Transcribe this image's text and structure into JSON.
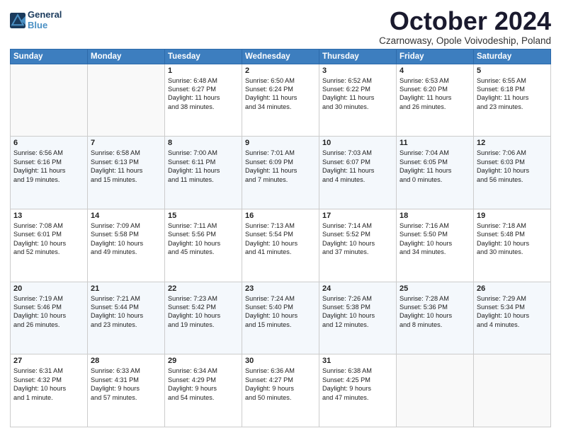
{
  "header": {
    "logo_line1": "General",
    "logo_line2": "Blue",
    "month": "October 2024",
    "location": "Czarnowasy, Opole Voivodeship, Poland"
  },
  "weekdays": [
    "Sunday",
    "Monday",
    "Tuesday",
    "Wednesday",
    "Thursday",
    "Friday",
    "Saturday"
  ],
  "weeks": [
    [
      {
        "day": "",
        "lines": [],
        "empty": true
      },
      {
        "day": "",
        "lines": [],
        "empty": true
      },
      {
        "day": "1",
        "lines": [
          "Sunrise: 6:48 AM",
          "Sunset: 6:27 PM",
          "Daylight: 11 hours",
          "and 38 minutes."
        ]
      },
      {
        "day": "2",
        "lines": [
          "Sunrise: 6:50 AM",
          "Sunset: 6:24 PM",
          "Daylight: 11 hours",
          "and 34 minutes."
        ]
      },
      {
        "day": "3",
        "lines": [
          "Sunrise: 6:52 AM",
          "Sunset: 6:22 PM",
          "Daylight: 11 hours",
          "and 30 minutes."
        ]
      },
      {
        "day": "4",
        "lines": [
          "Sunrise: 6:53 AM",
          "Sunset: 6:20 PM",
          "Daylight: 11 hours",
          "and 26 minutes."
        ]
      },
      {
        "day": "5",
        "lines": [
          "Sunrise: 6:55 AM",
          "Sunset: 6:18 PM",
          "Daylight: 11 hours",
          "and 23 minutes."
        ]
      }
    ],
    [
      {
        "day": "6",
        "lines": [
          "Sunrise: 6:56 AM",
          "Sunset: 6:16 PM",
          "Daylight: 11 hours",
          "and 19 minutes."
        ]
      },
      {
        "day": "7",
        "lines": [
          "Sunrise: 6:58 AM",
          "Sunset: 6:13 PM",
          "Daylight: 11 hours",
          "and 15 minutes."
        ]
      },
      {
        "day": "8",
        "lines": [
          "Sunrise: 7:00 AM",
          "Sunset: 6:11 PM",
          "Daylight: 11 hours",
          "and 11 minutes."
        ]
      },
      {
        "day": "9",
        "lines": [
          "Sunrise: 7:01 AM",
          "Sunset: 6:09 PM",
          "Daylight: 11 hours",
          "and 7 minutes."
        ]
      },
      {
        "day": "10",
        "lines": [
          "Sunrise: 7:03 AM",
          "Sunset: 6:07 PM",
          "Daylight: 11 hours",
          "and 4 minutes."
        ]
      },
      {
        "day": "11",
        "lines": [
          "Sunrise: 7:04 AM",
          "Sunset: 6:05 PM",
          "Daylight: 11 hours",
          "and 0 minutes."
        ]
      },
      {
        "day": "12",
        "lines": [
          "Sunrise: 7:06 AM",
          "Sunset: 6:03 PM",
          "Daylight: 10 hours",
          "and 56 minutes."
        ]
      }
    ],
    [
      {
        "day": "13",
        "lines": [
          "Sunrise: 7:08 AM",
          "Sunset: 6:01 PM",
          "Daylight: 10 hours",
          "and 52 minutes."
        ]
      },
      {
        "day": "14",
        "lines": [
          "Sunrise: 7:09 AM",
          "Sunset: 5:58 PM",
          "Daylight: 10 hours",
          "and 49 minutes."
        ]
      },
      {
        "day": "15",
        "lines": [
          "Sunrise: 7:11 AM",
          "Sunset: 5:56 PM",
          "Daylight: 10 hours",
          "and 45 minutes."
        ]
      },
      {
        "day": "16",
        "lines": [
          "Sunrise: 7:13 AM",
          "Sunset: 5:54 PM",
          "Daylight: 10 hours",
          "and 41 minutes."
        ]
      },
      {
        "day": "17",
        "lines": [
          "Sunrise: 7:14 AM",
          "Sunset: 5:52 PM",
          "Daylight: 10 hours",
          "and 37 minutes."
        ]
      },
      {
        "day": "18",
        "lines": [
          "Sunrise: 7:16 AM",
          "Sunset: 5:50 PM",
          "Daylight: 10 hours",
          "and 34 minutes."
        ]
      },
      {
        "day": "19",
        "lines": [
          "Sunrise: 7:18 AM",
          "Sunset: 5:48 PM",
          "Daylight: 10 hours",
          "and 30 minutes."
        ]
      }
    ],
    [
      {
        "day": "20",
        "lines": [
          "Sunrise: 7:19 AM",
          "Sunset: 5:46 PM",
          "Daylight: 10 hours",
          "and 26 minutes."
        ]
      },
      {
        "day": "21",
        "lines": [
          "Sunrise: 7:21 AM",
          "Sunset: 5:44 PM",
          "Daylight: 10 hours",
          "and 23 minutes."
        ]
      },
      {
        "day": "22",
        "lines": [
          "Sunrise: 7:23 AM",
          "Sunset: 5:42 PM",
          "Daylight: 10 hours",
          "and 19 minutes."
        ]
      },
      {
        "day": "23",
        "lines": [
          "Sunrise: 7:24 AM",
          "Sunset: 5:40 PM",
          "Daylight: 10 hours",
          "and 15 minutes."
        ]
      },
      {
        "day": "24",
        "lines": [
          "Sunrise: 7:26 AM",
          "Sunset: 5:38 PM",
          "Daylight: 10 hours",
          "and 12 minutes."
        ]
      },
      {
        "day": "25",
        "lines": [
          "Sunrise: 7:28 AM",
          "Sunset: 5:36 PM",
          "Daylight: 10 hours",
          "and 8 minutes."
        ]
      },
      {
        "day": "26",
        "lines": [
          "Sunrise: 7:29 AM",
          "Sunset: 5:34 PM",
          "Daylight: 10 hours",
          "and 4 minutes."
        ]
      }
    ],
    [
      {
        "day": "27",
        "lines": [
          "Sunrise: 6:31 AM",
          "Sunset: 4:32 PM",
          "Daylight: 10 hours",
          "and 1 minute."
        ]
      },
      {
        "day": "28",
        "lines": [
          "Sunrise: 6:33 AM",
          "Sunset: 4:31 PM",
          "Daylight: 9 hours",
          "and 57 minutes."
        ]
      },
      {
        "day": "29",
        "lines": [
          "Sunrise: 6:34 AM",
          "Sunset: 4:29 PM",
          "Daylight: 9 hours",
          "and 54 minutes."
        ]
      },
      {
        "day": "30",
        "lines": [
          "Sunrise: 6:36 AM",
          "Sunset: 4:27 PM",
          "Daylight: 9 hours",
          "and 50 minutes."
        ]
      },
      {
        "day": "31",
        "lines": [
          "Sunrise: 6:38 AM",
          "Sunset: 4:25 PM",
          "Daylight: 9 hours",
          "and 47 minutes."
        ]
      },
      {
        "day": "",
        "lines": [],
        "empty": true
      },
      {
        "day": "",
        "lines": [],
        "empty": true
      }
    ]
  ]
}
